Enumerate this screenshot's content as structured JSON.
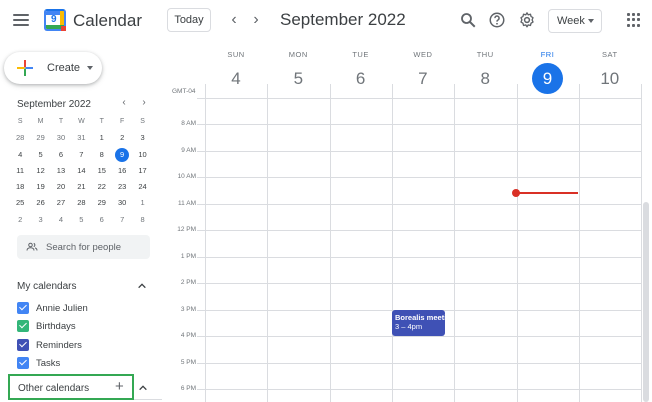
{
  "header": {
    "app_title": "Calendar",
    "logo_date": "9",
    "today_label": "Today",
    "prev_arrow": "‹",
    "next_arrow": "›",
    "month_title": "September 2022",
    "view_label": "Week"
  },
  "sidebar": {
    "create_label": "Create",
    "mini_calendar": {
      "title": "September 2022",
      "prev": "‹",
      "next": "›",
      "weekdays": [
        "S",
        "M",
        "T",
        "W",
        "T",
        "F",
        "S"
      ],
      "weeks": [
        [
          "28",
          "29",
          "30",
          "31",
          "1",
          "2",
          "3"
        ],
        [
          "4",
          "5",
          "6",
          "7",
          "8",
          "9",
          "10"
        ],
        [
          "11",
          "12",
          "13",
          "14",
          "15",
          "16",
          "17"
        ],
        [
          "18",
          "19",
          "20",
          "21",
          "22",
          "23",
          "24"
        ],
        [
          "25",
          "26",
          "27",
          "28",
          "29",
          "30",
          "1"
        ],
        [
          "2",
          "3",
          "4",
          "5",
          "6",
          "7",
          "8"
        ]
      ],
      "today": "9"
    },
    "search_people_placeholder": "Search for people",
    "my_calendars": {
      "title": "My calendars",
      "items": [
        {
          "label": "Annie Julien",
          "color": "#4285f4"
        },
        {
          "label": "Birthdays",
          "color": "#33b679"
        },
        {
          "label": "Reminders",
          "color": "#3f51b5"
        },
        {
          "label": "Tasks",
          "color": "#4285f4"
        }
      ]
    },
    "other_calendars": {
      "title": "Other calendars",
      "add_label": "+"
    }
  },
  "week": {
    "timezone": "GMT-04",
    "days": [
      {
        "name": "SUN",
        "num": "4"
      },
      {
        "name": "MON",
        "num": "5"
      },
      {
        "name": "TUE",
        "num": "6"
      },
      {
        "name": "WED",
        "num": "7"
      },
      {
        "name": "THU",
        "num": "8"
      },
      {
        "name": "FRI",
        "num": "9",
        "today": true
      },
      {
        "name": "SAT",
        "num": "10"
      }
    ],
    "hours": [
      "8 AM",
      "9 AM",
      "10 AM",
      "11 AM",
      "12 PM",
      "1 PM",
      "2 PM",
      "3 PM",
      "4 PM",
      "5 PM",
      "6 PM"
    ],
    "events": [
      {
        "title": "Borealis meeting",
        "time": "3 – 4pm",
        "color": "#3f51b5"
      }
    ]
  },
  "colors": {
    "accent": "#1a73e8",
    "now_indicator": "#d93025",
    "highlight_box": "#34a853"
  }
}
